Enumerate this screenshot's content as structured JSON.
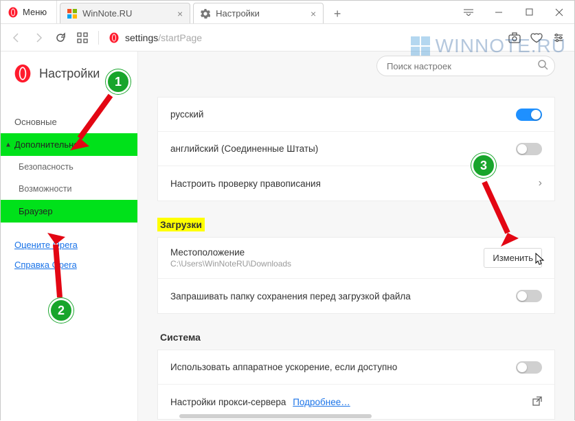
{
  "titlebar": {
    "menu_label": "Меню",
    "tabs": [
      {
        "title": "WinNote.RU"
      },
      {
        "title": "Настройки"
      }
    ]
  },
  "toolbar": {
    "url_scheme": "settings",
    "url_path": "/startPage"
  },
  "sidebar": {
    "heading": "Настройки",
    "items": [
      {
        "label": "Основные"
      },
      {
        "label": "Дополнительно"
      },
      {
        "label": "Безопасность"
      },
      {
        "label": "Возможности"
      },
      {
        "label": "Браузер"
      }
    ],
    "links": [
      {
        "label": "Оцените Opera"
      },
      {
        "label": "Справка Opera"
      }
    ]
  },
  "main": {
    "search_placeholder": "Поиск настроек",
    "lang_rows": [
      {
        "label": "русский"
      },
      {
        "label": "английский (Соединенные Штаты)"
      },
      {
        "label": "Настроить проверку правописания"
      }
    ],
    "downloads": {
      "title": "Загрузки",
      "location_label": "Местоположение",
      "location_value": "C:\\Users\\WinNoteRU\\Downloads",
      "change_btn": "Изменить",
      "ask_label": "Запрашивать папку сохранения перед загрузкой файла"
    },
    "system": {
      "title": "Система",
      "hwaccel_label": "Использовать аппаратное ускорение, если доступно",
      "proxy_label": "Настройки прокси-сервера",
      "proxy_link": "Подробнее…"
    }
  },
  "annotations": {
    "b1": "1",
    "b2": "2",
    "b3": "3"
  },
  "watermark": {
    "text": "WINNOTE.RU"
  }
}
